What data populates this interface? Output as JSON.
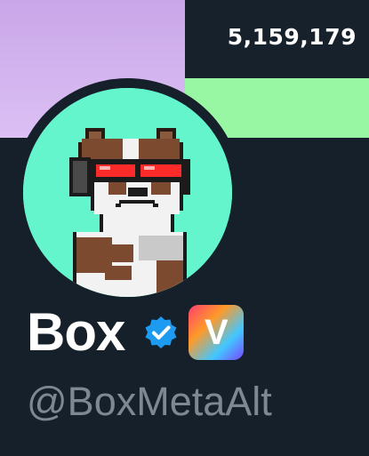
{
  "banner": {
    "count": "5,159,179",
    "colors": {
      "left": "#d6b7f2",
      "right_top": "#17212c",
      "right_bottom": "#98f7a3"
    }
  },
  "profile": {
    "avatar_description_icon": "pixel-dog-with-red-goggles-avatar",
    "avatar_bg": "#64f5cd",
    "display_name": "Box",
    "verified_icon": "verified-badge-icon",
    "badge_letter": "V",
    "handle": "@BoxMetaAlt"
  },
  "theme": {
    "background": "#16202b",
    "name_color": "#ffffff",
    "handle_color": "#7d8893"
  }
}
